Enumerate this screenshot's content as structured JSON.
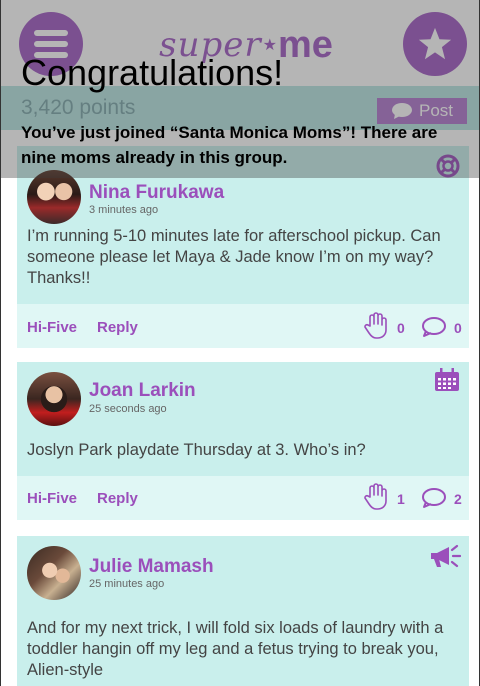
{
  "header": {
    "logo_super": "super",
    "logo_me": "me",
    "menu_icon": "hamburger-icon",
    "star_icon": "star-icon"
  },
  "points_bar": {
    "points": "3,420 points",
    "post_label": "Post"
  },
  "congrats": {
    "title": "Congratulations!",
    "message": "You’ve just joined “Santa Monica Moms”! There are nine moms already in this group."
  },
  "posts": [
    {
      "name": "Nina Furukawa",
      "time": "3 minutes ago",
      "text": "I’m running 5-10 minutes late for afterschool pickup. Can someone please let Maya & Jade know I’m on my way? Thanks!!",
      "hi_five_label": "Hi-Five",
      "reply_label": "Reply",
      "hi_five_count": "0",
      "reply_count": "0",
      "type_icon": "lifebuoy-icon"
    },
    {
      "name": "Joan Larkin",
      "time": "25 seconds ago",
      "text": "Joslyn Park playdate Thursday at 3. Who’s in?",
      "hi_five_label": "Hi-Five",
      "reply_label": "Reply",
      "hi_five_count": "1",
      "reply_count": "2",
      "type_icon": "calendar-icon"
    },
    {
      "name": "Julie Mamash",
      "time": "25 minutes ago",
      "text": "And for my next trick, I will fold six loads of laundry with a toddler hangin off my leg and a fetus trying to break you, Alien-style",
      "type_icon": "megaphone-icon"
    }
  ],
  "colors": {
    "brand_purple": "#a25cc4",
    "card_bg": "#c9efec",
    "action_bg": "#e0f7f5"
  }
}
